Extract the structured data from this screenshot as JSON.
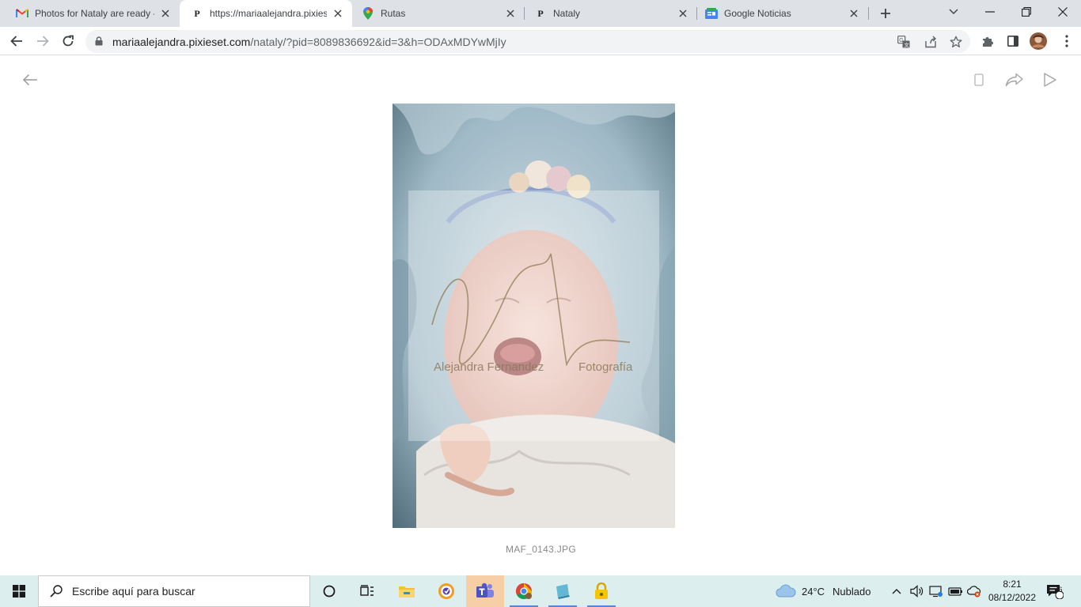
{
  "browser": {
    "tabs": [
      {
        "title": "Photos for Nataly are ready - ",
        "favicon": "gmail-icon",
        "active": false
      },
      {
        "title": "https://mariaalejandra.pixieset.",
        "favicon": "pixieset-icon",
        "active": true
      },
      {
        "title": "Rutas",
        "favicon": "maps-icon",
        "active": false
      },
      {
        "title": "Nataly",
        "favicon": "pixieset-icon",
        "active": false
      },
      {
        "title": "Google Noticias",
        "favicon": "google-news-icon",
        "active": false
      }
    ],
    "favicon_letter": "P",
    "url_host": "mariaalejandra.pixieset.com",
    "url_path": "/nataly/?pid=8089836692&id=3&h=ODAxMDYwMjIy"
  },
  "viewer": {
    "watermark_line1": "Alejandra Fernandez",
    "watermark_line2": "Fotografía",
    "caption": "MAF_0143.JPG"
  },
  "taskbar": {
    "search_placeholder": "Escribe aquí para buscar",
    "weather_temp": "24°C",
    "weather_desc": "Nublado",
    "time": "8:21",
    "date": "08/12/2022",
    "notification_count": "6"
  },
  "colors": {
    "tabstrip_bg": "#dee1e6",
    "taskbar_bg": "#dcefee",
    "accent_blue": "#1a73e8"
  }
}
